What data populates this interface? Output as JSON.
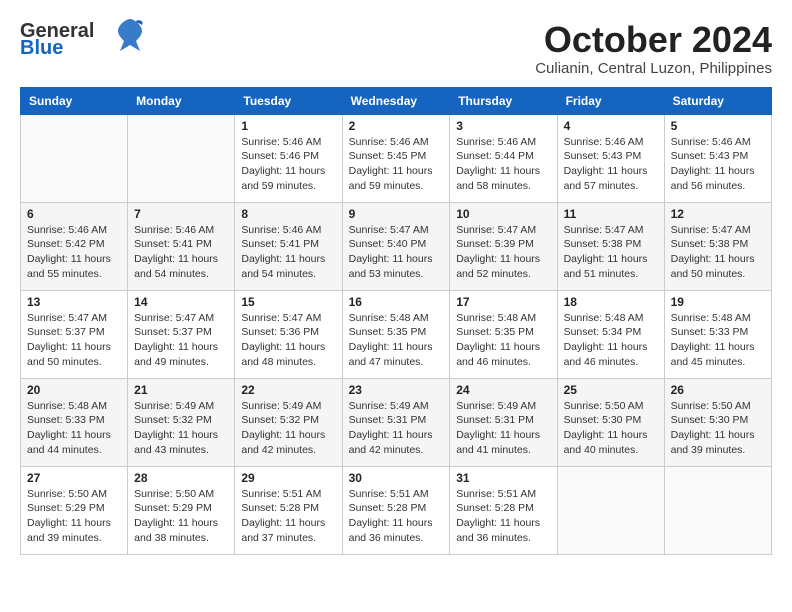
{
  "header": {
    "logo_general": "General",
    "logo_blue": "Blue",
    "month": "October 2024",
    "location": "Culianin, Central Luzon, Philippines"
  },
  "weekdays": [
    "Sunday",
    "Monday",
    "Tuesday",
    "Wednesday",
    "Thursday",
    "Friday",
    "Saturday"
  ],
  "weeks": [
    [
      {
        "day": "",
        "info": ""
      },
      {
        "day": "",
        "info": ""
      },
      {
        "day": "1",
        "info": "Sunrise: 5:46 AM\nSunset: 5:46 PM\nDaylight: 11 hours and 59 minutes."
      },
      {
        "day": "2",
        "info": "Sunrise: 5:46 AM\nSunset: 5:45 PM\nDaylight: 11 hours and 59 minutes."
      },
      {
        "day": "3",
        "info": "Sunrise: 5:46 AM\nSunset: 5:44 PM\nDaylight: 11 hours and 58 minutes."
      },
      {
        "day": "4",
        "info": "Sunrise: 5:46 AM\nSunset: 5:43 PM\nDaylight: 11 hours and 57 minutes."
      },
      {
        "day": "5",
        "info": "Sunrise: 5:46 AM\nSunset: 5:43 PM\nDaylight: 11 hours and 56 minutes."
      }
    ],
    [
      {
        "day": "6",
        "info": "Sunrise: 5:46 AM\nSunset: 5:42 PM\nDaylight: 11 hours and 55 minutes."
      },
      {
        "day": "7",
        "info": "Sunrise: 5:46 AM\nSunset: 5:41 PM\nDaylight: 11 hours and 54 minutes."
      },
      {
        "day": "8",
        "info": "Sunrise: 5:46 AM\nSunset: 5:41 PM\nDaylight: 11 hours and 54 minutes."
      },
      {
        "day": "9",
        "info": "Sunrise: 5:47 AM\nSunset: 5:40 PM\nDaylight: 11 hours and 53 minutes."
      },
      {
        "day": "10",
        "info": "Sunrise: 5:47 AM\nSunset: 5:39 PM\nDaylight: 11 hours and 52 minutes."
      },
      {
        "day": "11",
        "info": "Sunrise: 5:47 AM\nSunset: 5:38 PM\nDaylight: 11 hours and 51 minutes."
      },
      {
        "day": "12",
        "info": "Sunrise: 5:47 AM\nSunset: 5:38 PM\nDaylight: 11 hours and 50 minutes."
      }
    ],
    [
      {
        "day": "13",
        "info": "Sunrise: 5:47 AM\nSunset: 5:37 PM\nDaylight: 11 hours and 50 minutes."
      },
      {
        "day": "14",
        "info": "Sunrise: 5:47 AM\nSunset: 5:37 PM\nDaylight: 11 hours and 49 minutes."
      },
      {
        "day": "15",
        "info": "Sunrise: 5:47 AM\nSunset: 5:36 PM\nDaylight: 11 hours and 48 minutes."
      },
      {
        "day": "16",
        "info": "Sunrise: 5:48 AM\nSunset: 5:35 PM\nDaylight: 11 hours and 47 minutes."
      },
      {
        "day": "17",
        "info": "Sunrise: 5:48 AM\nSunset: 5:35 PM\nDaylight: 11 hours and 46 minutes."
      },
      {
        "day": "18",
        "info": "Sunrise: 5:48 AM\nSunset: 5:34 PM\nDaylight: 11 hours and 46 minutes."
      },
      {
        "day": "19",
        "info": "Sunrise: 5:48 AM\nSunset: 5:33 PM\nDaylight: 11 hours and 45 minutes."
      }
    ],
    [
      {
        "day": "20",
        "info": "Sunrise: 5:48 AM\nSunset: 5:33 PM\nDaylight: 11 hours and 44 minutes."
      },
      {
        "day": "21",
        "info": "Sunrise: 5:49 AM\nSunset: 5:32 PM\nDaylight: 11 hours and 43 minutes."
      },
      {
        "day": "22",
        "info": "Sunrise: 5:49 AM\nSunset: 5:32 PM\nDaylight: 11 hours and 42 minutes."
      },
      {
        "day": "23",
        "info": "Sunrise: 5:49 AM\nSunset: 5:31 PM\nDaylight: 11 hours and 42 minutes."
      },
      {
        "day": "24",
        "info": "Sunrise: 5:49 AM\nSunset: 5:31 PM\nDaylight: 11 hours and 41 minutes."
      },
      {
        "day": "25",
        "info": "Sunrise: 5:50 AM\nSunset: 5:30 PM\nDaylight: 11 hours and 40 minutes."
      },
      {
        "day": "26",
        "info": "Sunrise: 5:50 AM\nSunset: 5:30 PM\nDaylight: 11 hours and 39 minutes."
      }
    ],
    [
      {
        "day": "27",
        "info": "Sunrise: 5:50 AM\nSunset: 5:29 PM\nDaylight: 11 hours and 39 minutes."
      },
      {
        "day": "28",
        "info": "Sunrise: 5:50 AM\nSunset: 5:29 PM\nDaylight: 11 hours and 38 minutes."
      },
      {
        "day": "29",
        "info": "Sunrise: 5:51 AM\nSunset: 5:28 PM\nDaylight: 11 hours and 37 minutes."
      },
      {
        "day": "30",
        "info": "Sunrise: 5:51 AM\nSunset: 5:28 PM\nDaylight: 11 hours and 36 minutes."
      },
      {
        "day": "31",
        "info": "Sunrise: 5:51 AM\nSunset: 5:28 PM\nDaylight: 11 hours and 36 minutes."
      },
      {
        "day": "",
        "info": ""
      },
      {
        "day": "",
        "info": ""
      }
    ]
  ]
}
